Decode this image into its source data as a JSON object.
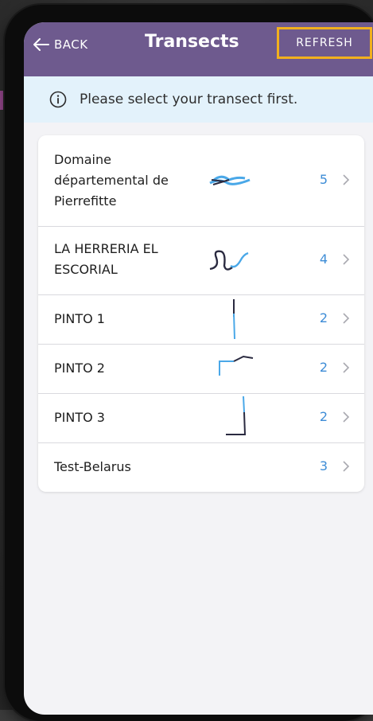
{
  "header": {
    "back_label": "BACK",
    "title": "Transects",
    "refresh_label": "REFRESH"
  },
  "info": {
    "message": "Please select your transect first."
  },
  "transects": [
    {
      "name_lines": [
        "Domaine",
        "départemental de",
        "Pierrefitte"
      ],
      "count": "5"
    },
    {
      "name_lines": [
        "LA HERRERIA EL",
        "ESCORIAL"
      ],
      "count": "4"
    },
    {
      "name_lines": [
        "PINTO 1"
      ],
      "count": "2"
    },
    {
      "name_lines": [
        "PINTO 2"
      ],
      "count": "2"
    },
    {
      "name_lines": [
        "PINTO 3"
      ],
      "count": "2"
    },
    {
      "name_lines": [
        "Test-Belarus"
      ],
      "count": "3"
    }
  ],
  "colors": {
    "toolbar": "#6e5a8e",
    "highlight": "#f2b01e",
    "accent_blue": "#3d8cd6",
    "banner": "#e3f2fb",
    "callout_arrow": "#9b4b93"
  },
  "icons": {
    "back": "arrow-left-icon",
    "info": "info-circle-icon",
    "row_chevron": "chevron-right-icon"
  }
}
